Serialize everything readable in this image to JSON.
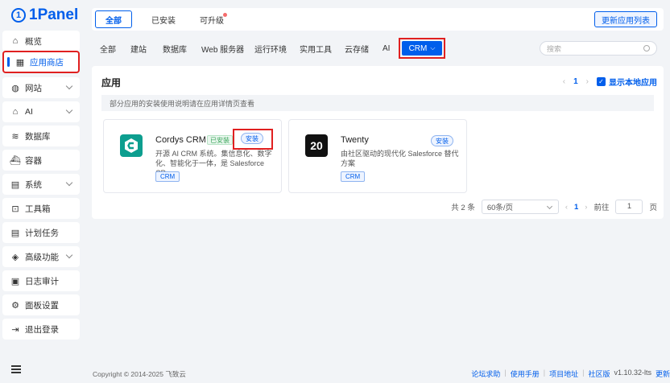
{
  "sidebar": {
    "logo": "1Panel",
    "items": [
      {
        "label": "概览",
        "icon": "home-icon"
      },
      {
        "label": "应用商店",
        "icon": "apps-icon"
      },
      {
        "label": "网站",
        "icon": "globe-icon"
      },
      {
        "label": "AI",
        "icon": "robot-icon"
      },
      {
        "label": "数据库",
        "icon": "database-icon"
      },
      {
        "label": "容器",
        "icon": "ship-icon"
      },
      {
        "label": "系统",
        "icon": "system-icon"
      },
      {
        "label": "工具箱",
        "icon": "toolbox-icon"
      },
      {
        "label": "计划任务",
        "icon": "schedule-icon"
      },
      {
        "label": "高级功能",
        "icon": "diamond-icon"
      },
      {
        "label": "日志审计",
        "icon": "log-icon"
      },
      {
        "label": "面板设置",
        "icon": "settings-icon"
      },
      {
        "label": "退出登录",
        "icon": "logout-icon"
      }
    ]
  },
  "topbar": {
    "tabs": [
      "全部",
      "已安装",
      "可升级"
    ],
    "update_button": "更新应用列表"
  },
  "categories": {
    "items": [
      "全部",
      "建站",
      "数据库",
      "Web 服务器",
      "运行环境",
      "实用工具",
      "云存储",
      "AI"
    ],
    "active": "CRM",
    "search_placeholder": "搜索"
  },
  "panel": {
    "title": "应用",
    "page": "1",
    "show_local": "显示本地应用",
    "notice": "部分应用的安装使用说明请在应用详情页查看"
  },
  "apps": [
    {
      "name": "Cordys CRM",
      "installed_badge": "已安装",
      "install": "安装",
      "desc": "开源 AI CRM 系统。集信息化、数字化、智能化于一体，是 Salesforce CR...",
      "tag": "CRM",
      "icon_color": "#0d9e8f"
    },
    {
      "name": "Twenty",
      "install": "安装",
      "desc": "由社区驱动的现代化 Salesforce 替代方案",
      "tag": "CRM",
      "icon_text": "20",
      "icon_color": "#111111"
    }
  ],
  "pagination": {
    "total": "共 2 条",
    "page_size": "60条/页",
    "page": "1",
    "goto_label": "前往",
    "goto_value": "1",
    "page_suffix": "页"
  },
  "footer": {
    "copyright": "Copyright © 2014-2025 飞致云",
    "links": [
      "论坛求助",
      "使用手册",
      "项目地址",
      "社区版"
    ],
    "version": "v1.10.32-lts",
    "update": "更新"
  },
  "colors": {
    "accent": "#005eeb",
    "highlight_box": "#e02020"
  }
}
